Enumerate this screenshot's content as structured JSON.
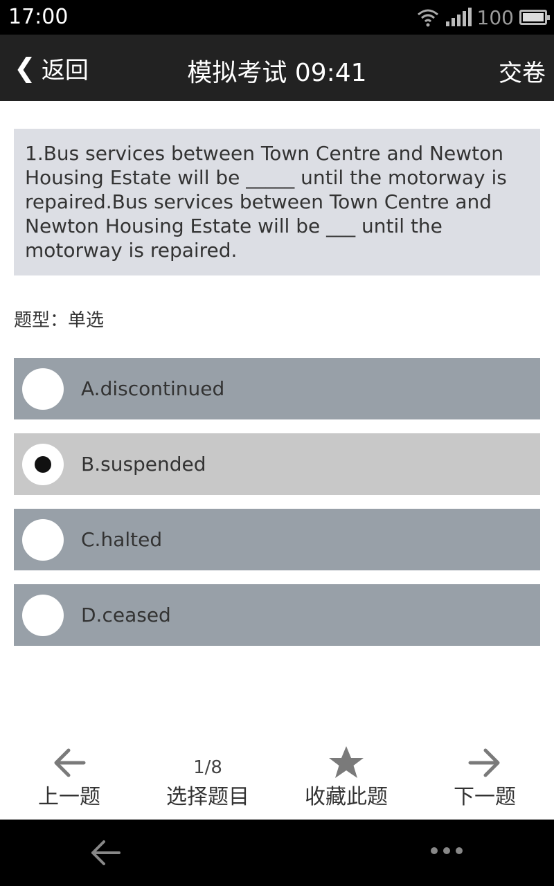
{
  "status_bar": {
    "time": "17:00",
    "battery": "100",
    "icons": [
      "wifi-icon",
      "signal-icon",
      "battery-icon"
    ]
  },
  "header": {
    "back_label": "返回",
    "title": "模拟考试 09:41",
    "submit_label": "交卷"
  },
  "question": {
    "text": "1.Bus services between Town Centre and Newton Housing Estate will be _____ until the motorway is repaired.Bus services between Town Centre and Newton Housing Estate will be ___ until the motorway is repaired.",
    "type_label": "题型：单选"
  },
  "options": [
    {
      "label": "A.discontinued",
      "selected": false
    },
    {
      "label": "B.suspended",
      "selected": true
    },
    {
      "label": "C.halted",
      "selected": false
    },
    {
      "label": "D.ceased",
      "selected": false
    }
  ],
  "toolbar": {
    "prev_label": "上一题",
    "page_counter": "1/8",
    "select_label": "选择题目",
    "favorite_label": "收藏此题",
    "next_label": "下一题"
  },
  "colors": {
    "header_bg": "#222222",
    "question_bg": "#dcdee4",
    "option_bg": "#98a0a8",
    "option_selected_bg": "#c8c8c8",
    "icon_gray": "#7a7a7a"
  }
}
